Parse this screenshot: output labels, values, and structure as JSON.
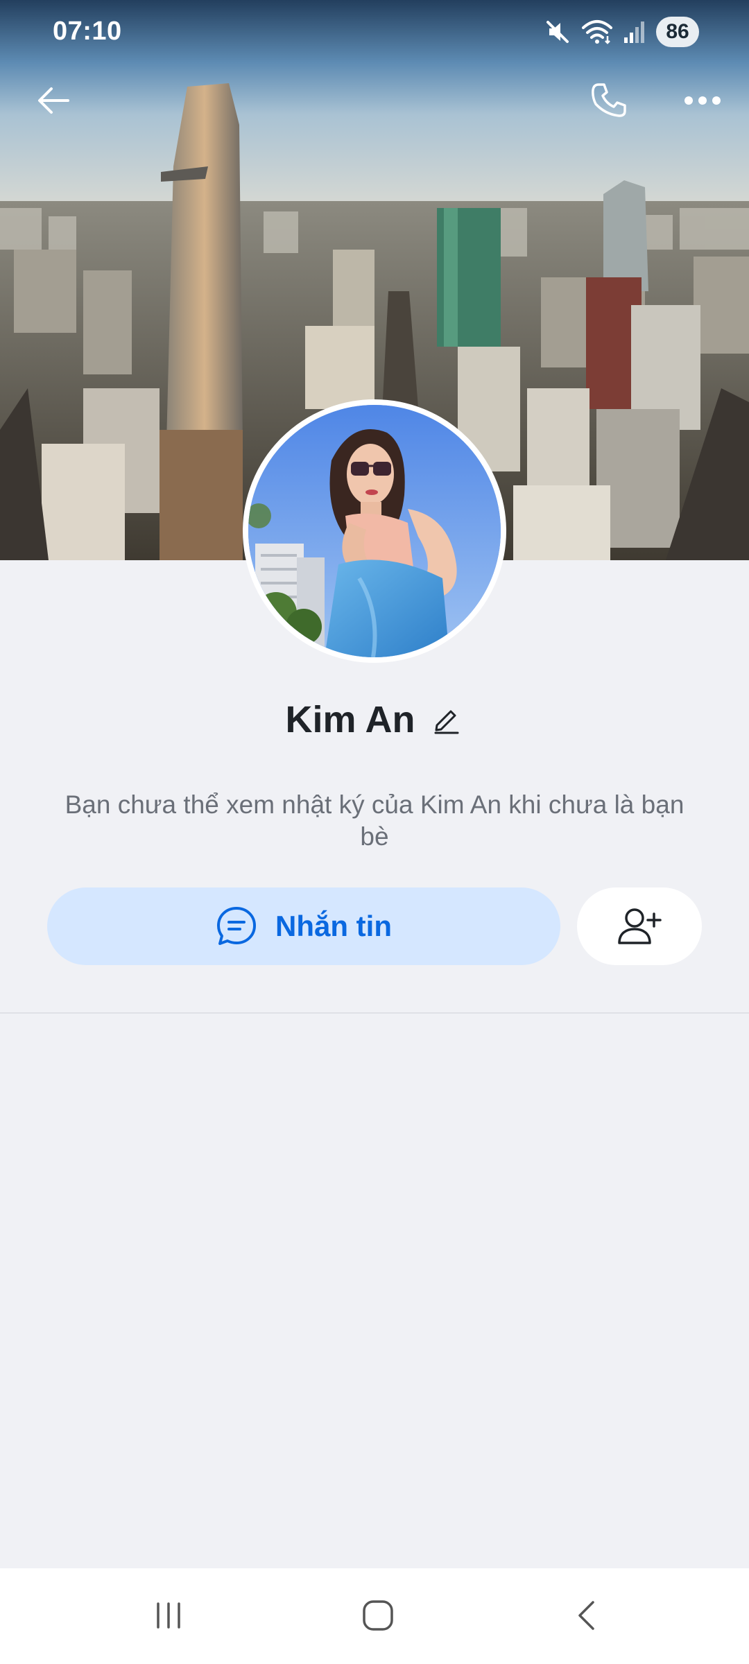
{
  "status_bar": {
    "time": "07:10",
    "battery": "86",
    "icons": [
      "mute-icon",
      "wifi-icon",
      "signal-icon",
      "battery-icon"
    ]
  },
  "top_bar": {
    "icons": [
      "back-arrow-icon",
      "phone-icon",
      "more-dots-icon"
    ]
  },
  "profile": {
    "name": "Kim An",
    "privacy_note": "Bạn chưa thể xem nhật ký của Kim An khi chưa là bạn bè"
  },
  "actions": {
    "message_label": "Nhắn tin",
    "message_icon": "chat-bubble-icon",
    "add_friend_icon": "add-user-icon"
  },
  "nav_bar": {
    "icons": [
      "recents-icon",
      "home-icon",
      "back-chevron-icon"
    ]
  },
  "colors": {
    "accent": "#0a68e0",
    "message_button_bg": "#d5e7ff",
    "page_bg": "#f0f1f5"
  }
}
